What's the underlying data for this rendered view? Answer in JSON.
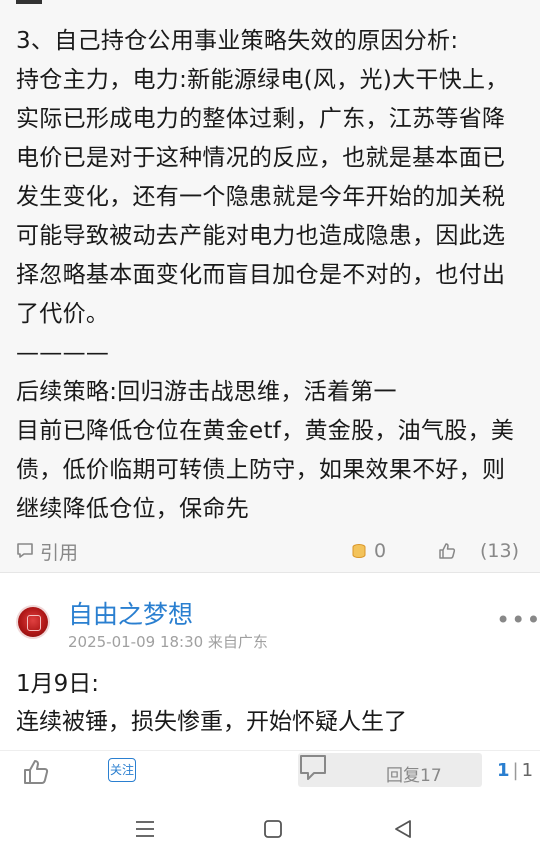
{
  "post1": {
    "lines": [
      "3、自己持仓公用事业策略失效的原因分析:",
      "持仓主力，电力:新能源绿电(风，光)大干快上，",
      "实际已形成电力的整体过剩，广东，江苏等省降",
      "电价已是对于这种情况的反应，也就是基本面已",
      "发生变化，还有一个隐患就是今年开始的加关税",
      "可能导致被动去产能对电力也造成隐患，因此选",
      "择忽略基本面变化而盲目加仓是不对的，也付出",
      "了代价。",
      "————",
      "后续策略:回归游击战思维，活着第一",
      "目前已降低仓位在黄金etf，黄金股，油气股，美",
      "债，低价临期可转债上防守，如果效果不好，则",
      "继续降低仓位，保命先"
    ],
    "actions": {
      "quote_label": "引用",
      "coin_count": "0",
      "like_count": "(13)"
    }
  },
  "post2": {
    "username": "自由之梦想",
    "meta": "2025-01-09 18:30 来自广东",
    "more": "•••",
    "lines": [
      "1月9日:",
      "连续被锤，损失惨重，开始怀疑人生了"
    ]
  },
  "bottom_bar": {
    "follow_label": "关注",
    "reply_label": "回复17",
    "page_current": "1",
    "page_sep": "|",
    "page_total": "1"
  },
  "colors": {
    "accent": "#2a7fd0",
    "muted": "#888888",
    "coin": "#e8a93b"
  },
  "icons": [
    "quote-icon",
    "coin-icon",
    "thumbs-up-icon",
    "more-icon",
    "comment-icon",
    "menu-icon",
    "home-icon",
    "back-icon"
  ]
}
